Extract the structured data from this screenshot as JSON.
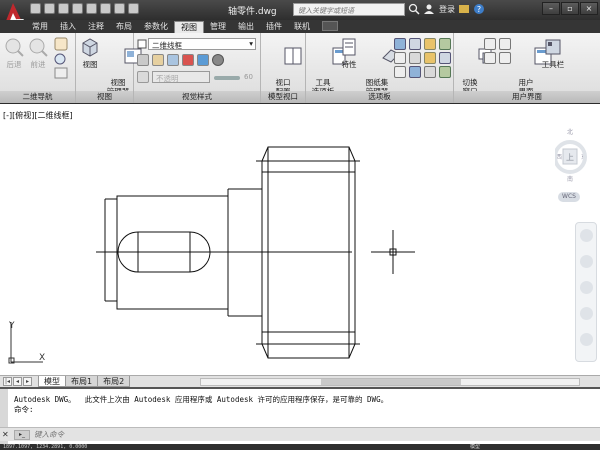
{
  "title": {
    "doc": "轴零件.dwg",
    "search_placeholder": "键入关键字或短语",
    "login": "登录"
  },
  "tabs": [
    "常用",
    "插入",
    "注释",
    "布局",
    "参数化",
    "视图",
    "管理",
    "输出",
    "插件",
    "联机"
  ],
  "active_tab": "视图",
  "ribbon": {
    "nav2d": {
      "title": "二维导航",
      "back": "后退",
      "forward": "前进"
    },
    "views": {
      "title": "视图",
      "btn_view": "视图",
      "btn_manager": "视图\n管理器"
    },
    "visual": {
      "title": "视觉样式",
      "combo_style": "二维线框",
      "combo_disabled": "不透明",
      "value": "60"
    },
    "model_vp": {
      "title": "模型视口",
      "btn": "视口\n配置"
    },
    "palettes": {
      "title": "选项板",
      "tool": "工具\n选项板",
      "props": "特性",
      "sheet": "图纸集\n管理器"
    },
    "ui": {
      "title": "用户界面",
      "switch": "切换\n窗口",
      "user": "用户\n界面",
      "toolbar": "工具栏"
    }
  },
  "viewport": {
    "label": "[-][俯视][二维线框]",
    "wcs": "WCS",
    "viewcube_top": "上",
    "viewcube_n": "北",
    "viewcube_s": "南",
    "viewcube_e": "东",
    "viewcube_w": "西",
    "ucs_x": "X",
    "ucs_y": "Y"
  },
  "layout_tabs": [
    "模型",
    "布局1",
    "布局2"
  ],
  "active_layout": "模型",
  "command": {
    "history1": "Autodesk DWG。  此文件上次由 Autodesk 应用程序或 Autodesk 许可的应用程序保存，是可靠的 DWG。",
    "history2": "命令:",
    "placeholder": "键入命令"
  },
  "status": {
    "coords": "1897.1097, 1234.2891, 0.0000",
    "model": "模型"
  },
  "colors": {
    "logo_red": "#c0282d",
    "ribbon_bg": "#e8e8e8",
    "drawing_line": "#111111"
  }
}
